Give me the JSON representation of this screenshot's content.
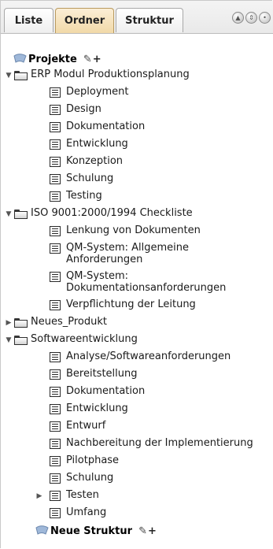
{
  "tabs": [
    {
      "label": "Liste"
    },
    {
      "label": "Ordner"
    },
    {
      "label": "Struktur"
    }
  ],
  "tree": {
    "root1_label": "Projekte",
    "root2_label": "Neue Struktur",
    "items": [
      "ERP Modul Produktionsplanung",
      "Deployment",
      "Design",
      "Dokumentation",
      "Entwicklung",
      "Konzeption",
      "Schulung",
      "Testing",
      "ISO 9001:2000/1994 Checkliste",
      "Lenkung von Dokumenten",
      "QM-System: Allgemeine",
      "Anforderungen",
      "QM-System:",
      "Dokumentationsanforderungen",
      "Verpflichtung der Leitung",
      "Neues_Produkt",
      "Softwareentwicklung",
      "Analyse/Softwareanforderungen",
      "Bereitstellung",
      "Dokumentation",
      "Entwicklung",
      "Entwurf",
      "Nachbereitung der Implementierung",
      "Pilotphase",
      "Schulung",
      "Testen",
      "Umfang"
    ]
  }
}
